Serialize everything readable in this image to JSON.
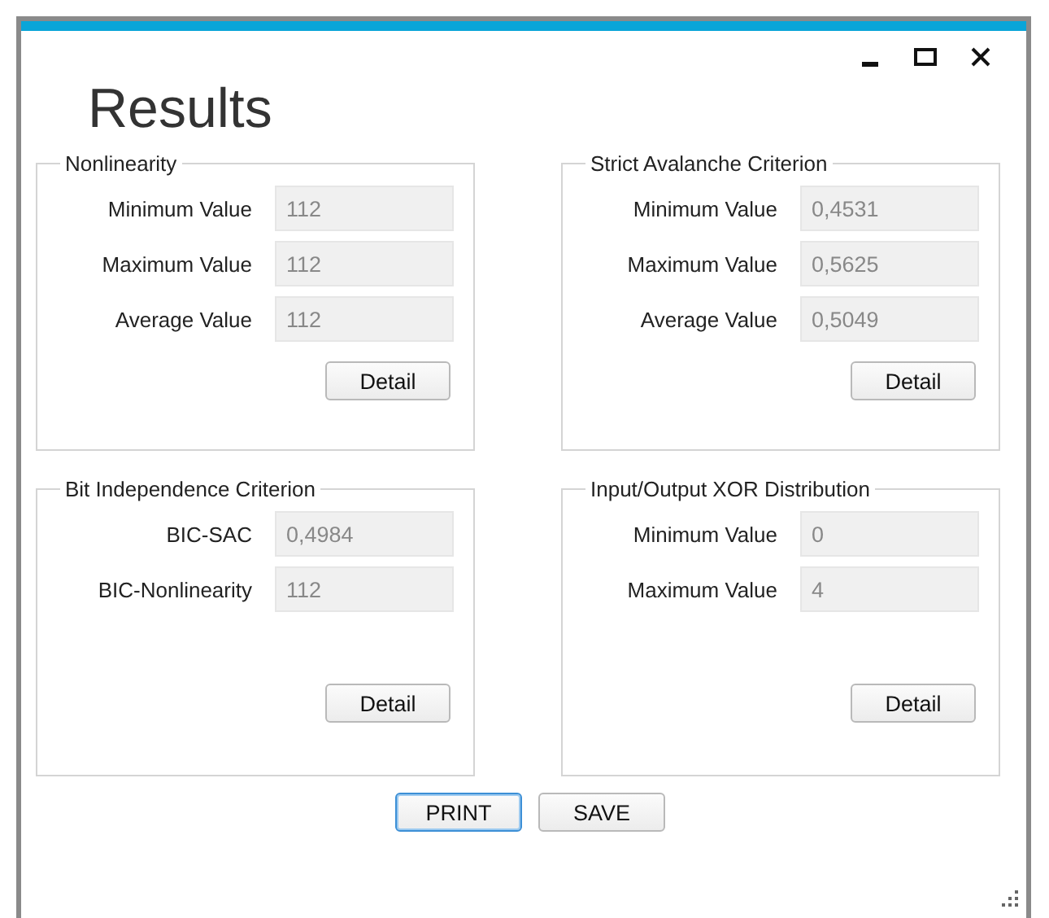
{
  "window": {
    "title": "Results",
    "controls": [
      {
        "kind": "minimize"
      },
      {
        "kind": "maximize"
      },
      {
        "kind": "close"
      }
    ]
  },
  "groups": [
    {
      "title": "Nonlinearity",
      "fields": [
        {
          "label": "Minimum Value",
          "value": "112"
        },
        {
          "label": "Maximum Value",
          "value": "112"
        },
        {
          "label": "Average Value",
          "value": "112"
        }
      ],
      "button": "Detail"
    },
    {
      "title": "Strict Avalanche Criterion",
      "fields": [
        {
          "label": "Minimum Value",
          "value": "0,4531"
        },
        {
          "label": "Maximum Value",
          "value": "0,5625"
        },
        {
          "label": "Average Value",
          "value": "0,5049"
        }
      ],
      "button": "Detail"
    },
    {
      "title": "Bit Independence Criterion",
      "fields": [
        {
          "label": "BIC-SAC",
          "value": "0,4984"
        },
        {
          "label": "BIC-Nonlinearity",
          "value": "112"
        }
      ],
      "button": "Detail"
    },
    {
      "title": "Input/Output XOR Distribution",
      "fields": [
        {
          "label": "Minimum Value",
          "value": "0"
        },
        {
          "label": "Maximum Value",
          "value": "4"
        }
      ],
      "button": "Detail"
    }
  ],
  "buttons": [
    {
      "label": "PRINT",
      "focused": true
    },
    {
      "label": "SAVE",
      "focused": false
    }
  ]
}
